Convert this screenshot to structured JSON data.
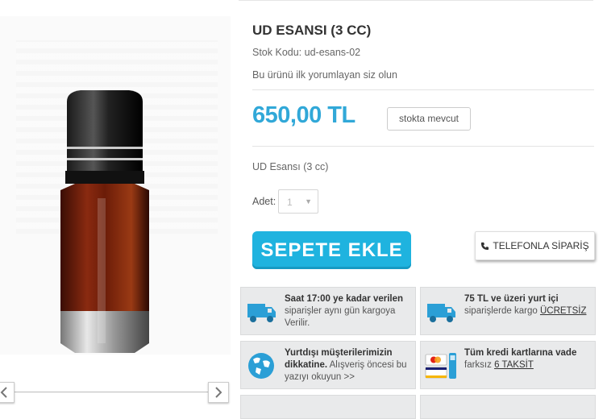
{
  "product": {
    "title": "UD ESANSI (3 CC)",
    "sku": "Stok Kodu: ud-esans-02",
    "review_prompt": "Bu ürünü ilk yorumlayan siz olun",
    "price": "650,00 TL",
    "stock_status": "stokta mevcut",
    "description": "UD Esansı (3 cc)",
    "quantity_label": "Adet:",
    "quantity_value": "1"
  },
  "actions": {
    "add_to_cart": "SEPETE EKLE",
    "phone_order": "TELEFONLA SİPARİŞ"
  },
  "info_boxes": [
    {
      "bold": "Saat 17:00 ye kadar verilen",
      "text": " siparişler aynı gün kargoya Verilir.",
      "link": ""
    },
    {
      "bold": "75 TL ve üzeri yurt içi",
      "text": " siparişlerde kargo ",
      "link": "ÜCRETSİZ"
    },
    {
      "bold": "Yurtdışı müşterilerimizin dikkatine.",
      "text": " Alışveriş öncesi bu yazıyı okuyun >>",
      "link": ""
    },
    {
      "bold": "Tüm kredi kartlarına vade",
      "text": " farksız ",
      "link": "6 TAKSİT"
    }
  ],
  "colors": {
    "accent": "#1fb3df",
    "price": "#31a8d8",
    "info_bg": "#e9eaeb"
  },
  "icons": [
    "truck-icon",
    "truck-icon",
    "globe-icon",
    "credit-card-icon",
    "chevron-left-icon",
    "chevron-right-icon",
    "phone-icon"
  ]
}
